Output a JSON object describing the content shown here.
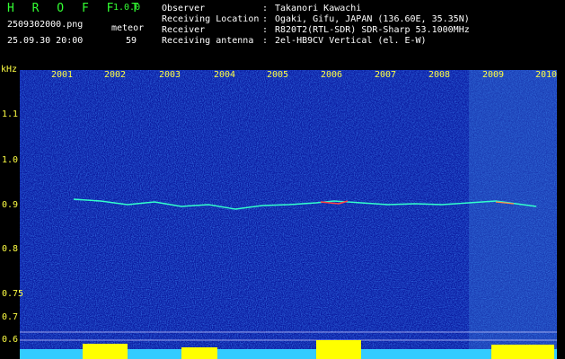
{
  "header": {
    "app_title": "H R O F F T",
    "version": "1.0.0",
    "file_name": "2509302000.png",
    "datetime": "25.09.30 20:00",
    "meteor_label": "meteor",
    "meteor_count": "59"
  },
  "info": [
    {
      "key": "Observer",
      "value": "Takanori Kawachi"
    },
    {
      "key": "Receiving Location",
      "value": "Ogaki, Gifu, JAPAN (136.60E, 35.35N)"
    },
    {
      "key": "Receiver",
      "value": "R820T2(RTL-SDR) SDR-Sharp 53.1000MHz"
    },
    {
      "key": "Receiving antenna",
      "value": "2el-HB9CV Vertical (el. E-W)"
    }
  ],
  "spectrogram": {
    "unit": "kHz",
    "x_labels": [
      "2001",
      "2002",
      "2003",
      "2004",
      "2005",
      "2006",
      "2007",
      "2008",
      "2009",
      "2010"
    ],
    "y_labels": [
      "1.1",
      "1.0",
      "0.9",
      "0.8",
      "0.75",
      "0.7",
      "0.6"
    ],
    "colors": {
      "background": "#0a1aa0",
      "label": "#ffff44",
      "title": "#33ff33",
      "trace": "#33ffcc",
      "level": "#ffff00"
    }
  }
}
